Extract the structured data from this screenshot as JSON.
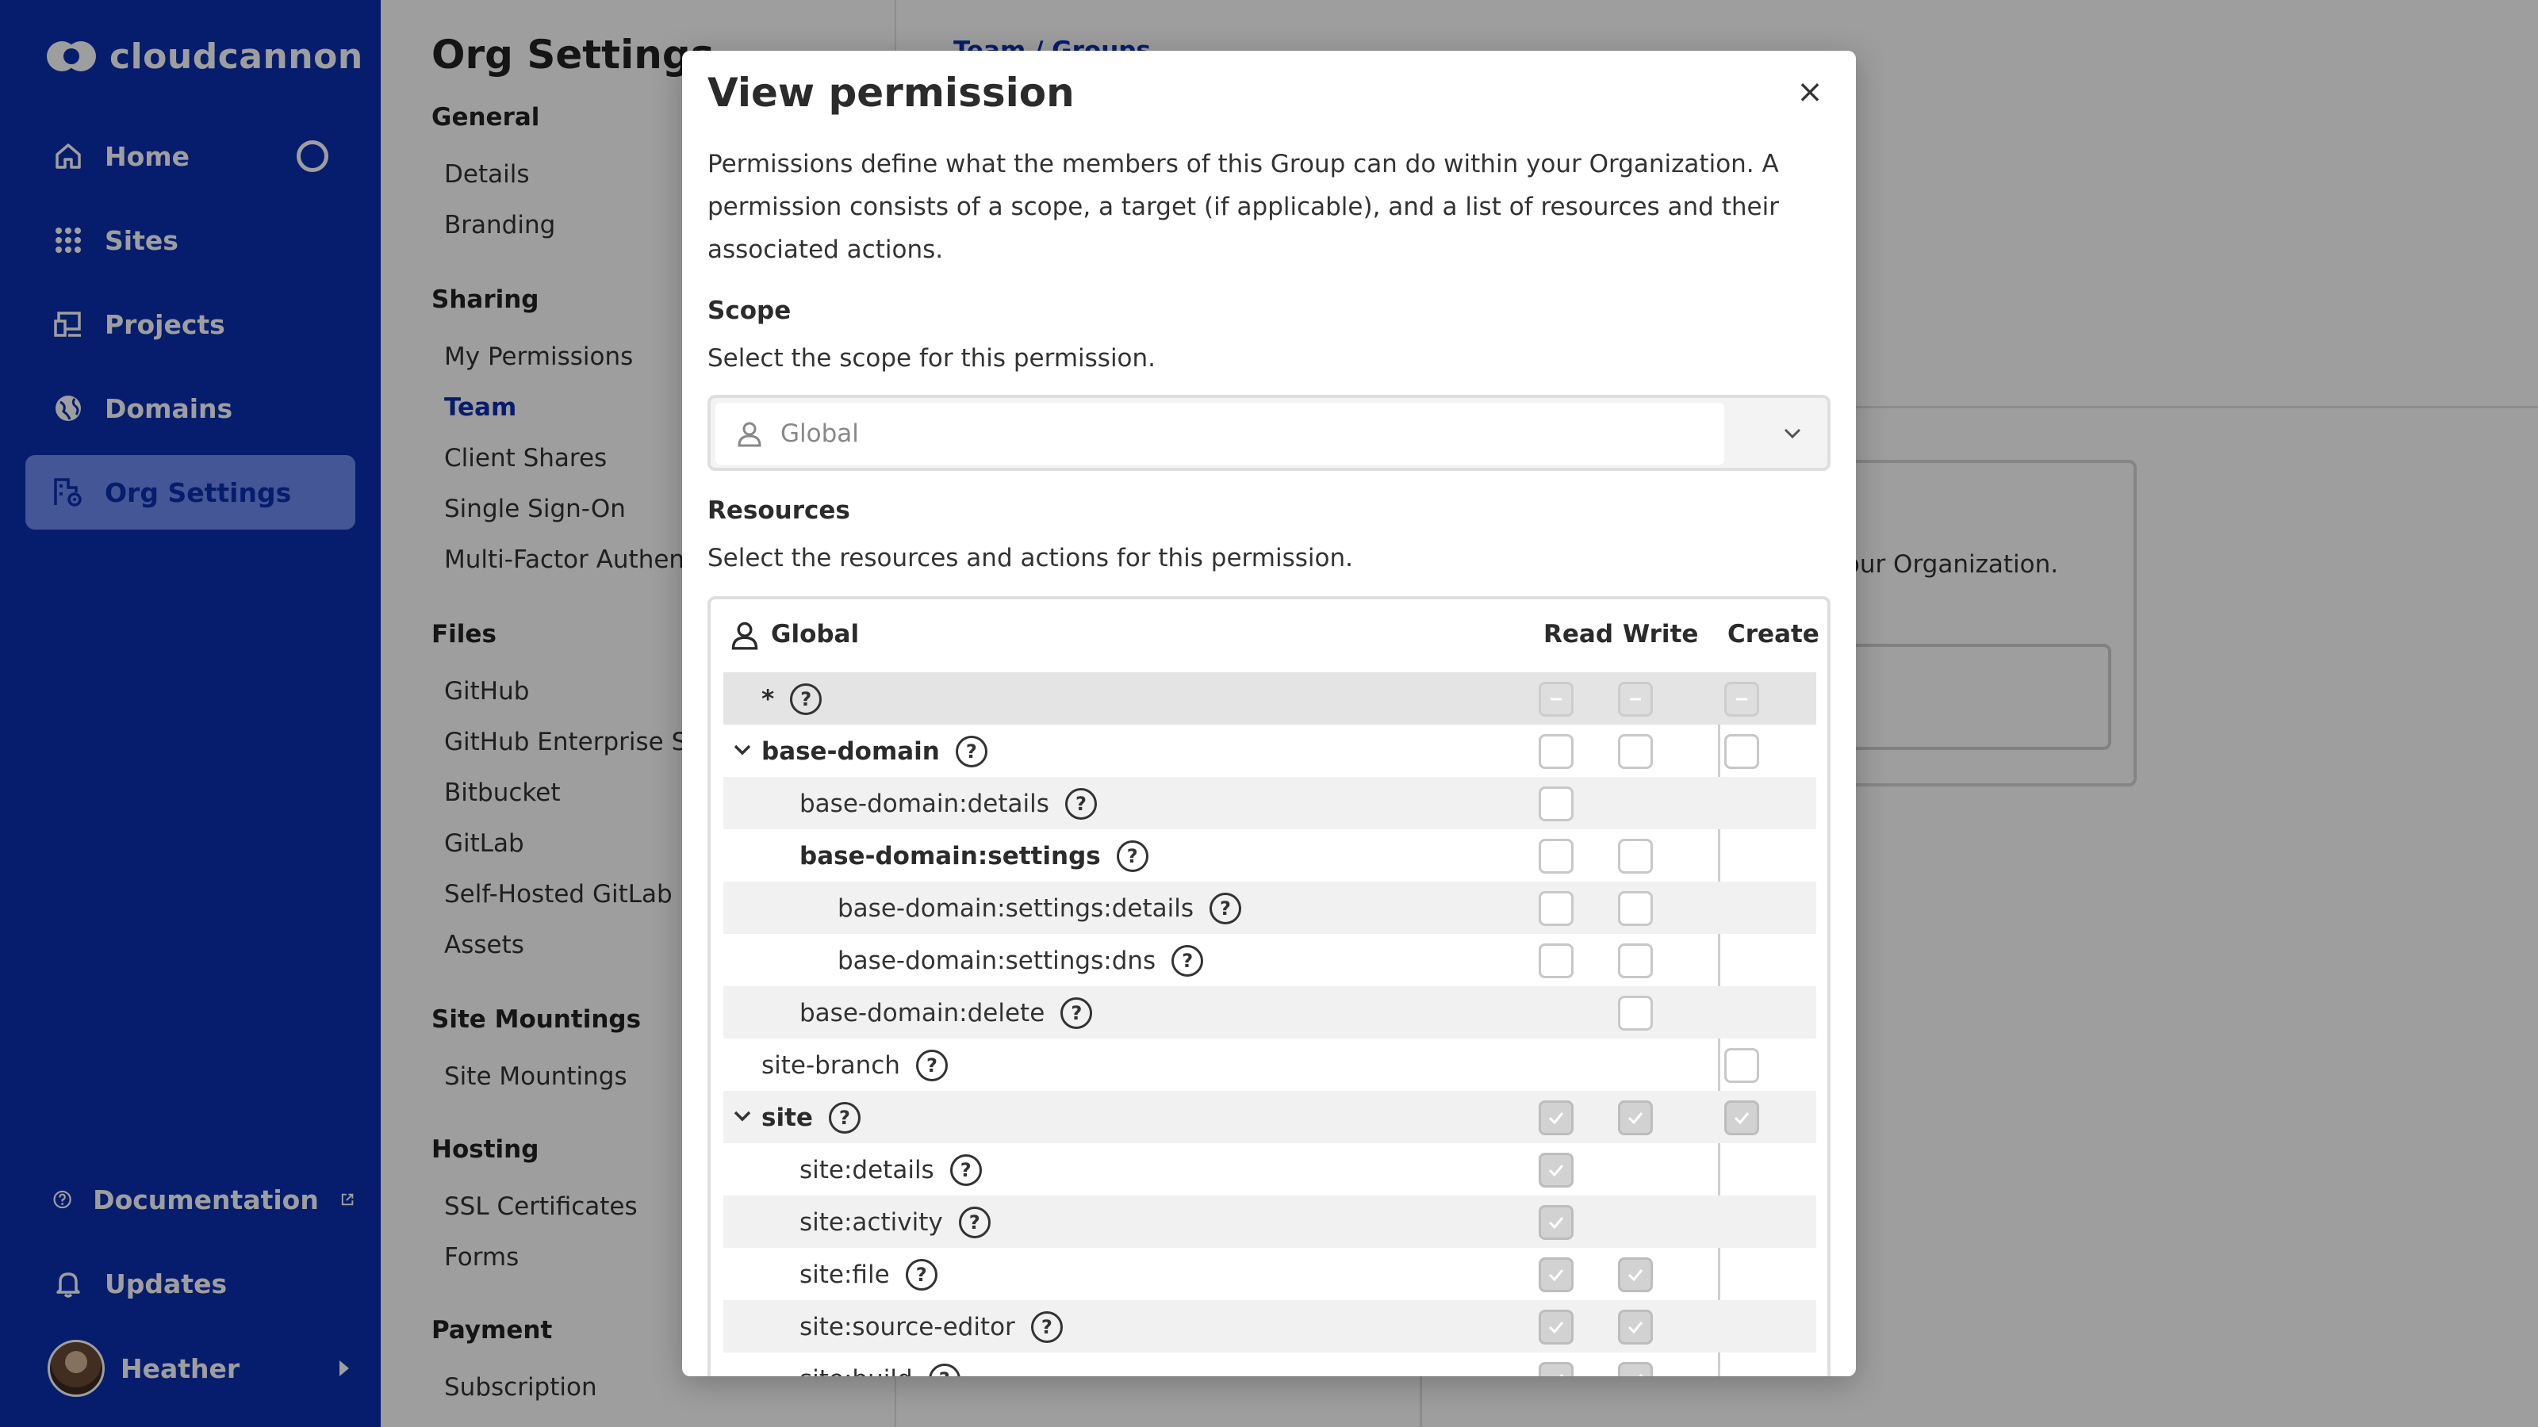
{
  "app": {
    "brand": "cloudcannon"
  },
  "sidebar": {
    "items": [
      {
        "label": "Home",
        "icon": "home-icon"
      },
      {
        "label": "Sites",
        "icon": "grid-icon"
      },
      {
        "label": "Projects",
        "icon": "projects-icon"
      },
      {
        "label": "Domains",
        "icon": "globe-icon"
      },
      {
        "label": "Org Settings",
        "icon": "org-settings-icon",
        "active": true
      }
    ],
    "bottom": [
      {
        "label": "Documentation",
        "icon": "help-icon"
      },
      {
        "label": "Updates",
        "icon": "bell-icon"
      }
    ],
    "user": {
      "name": "Heather"
    }
  },
  "settings": {
    "title": "Org Settings",
    "groups": [
      {
        "title": "General",
        "links": [
          "Details",
          "Branding"
        ]
      },
      {
        "title": "Sharing",
        "links": [
          "My Permissions",
          "Team",
          "Client Shares",
          "Single Sign-On",
          "Multi-Factor Authentication"
        ]
      },
      {
        "title": "Files",
        "links": [
          "GitHub",
          "GitHub Enterprise Server",
          "Bitbucket",
          "GitLab",
          "Self-Hosted GitLab",
          "Assets"
        ]
      },
      {
        "title": "Site Mountings",
        "links": [
          "Site Mountings"
        ]
      },
      {
        "title": "Hosting",
        "links": [
          "SSL Certificates",
          "Forms"
        ]
      },
      {
        "title": "Payment",
        "links": [
          "Subscription"
        ]
      }
    ],
    "current": "Team"
  },
  "main": {
    "breadcrumb": "Team / Groups",
    "background_text": "n your Organization."
  },
  "modal": {
    "title": "View permission",
    "close_label": "×",
    "intro": "Permissions define what the members of this Group can do within your Organization. A permission consists of a scope, a target (if applicable), and a list of resources and their associated actions.",
    "scope": {
      "title": "Scope",
      "description": "Select the scope for this permission.",
      "value": "Global"
    },
    "resources": {
      "title": "Resources",
      "description": "Select the resources and actions for this permission.",
      "table_title": "Global",
      "columns": [
        "Read",
        "Write",
        "Create"
      ],
      "rows": [
        {
          "label": "*",
          "level": 0,
          "bold": true,
          "read": "indeterminate",
          "write": "indeterminate",
          "create": "indeterminate"
        },
        {
          "label": "base-domain",
          "level": 0,
          "bold": true,
          "expander": true,
          "read": "unchecked",
          "write": "unchecked",
          "create": "unchecked"
        },
        {
          "label": "base-domain:details",
          "level": 1,
          "bold": false,
          "read": "unchecked",
          "write": null,
          "create": null
        },
        {
          "label": "base-domain:settings",
          "level": 1,
          "bold": true,
          "read": "unchecked",
          "write": "unchecked",
          "create": null
        },
        {
          "label": "base-domain:settings:details",
          "level": 2,
          "bold": false,
          "read": "unchecked",
          "write": "unchecked",
          "create": null
        },
        {
          "label": "base-domain:settings:dns",
          "level": 2,
          "bold": false,
          "read": "unchecked",
          "write": "unchecked",
          "create": null
        },
        {
          "label": "base-domain:delete",
          "level": 1,
          "bold": false,
          "read": null,
          "write": "unchecked",
          "create": null
        },
        {
          "label": "site-branch",
          "level": 0,
          "bold": false,
          "read": null,
          "write": null,
          "create": "unchecked"
        },
        {
          "label": "site",
          "level": 0,
          "bold": true,
          "expander": true,
          "read": "checked",
          "write": "checked",
          "create": "checked"
        },
        {
          "label": "site:details",
          "level": 1,
          "bold": false,
          "read": "checked",
          "write": null,
          "create": null
        },
        {
          "label": "site:activity",
          "level": 1,
          "bold": false,
          "read": "checked",
          "write": null,
          "create": null
        },
        {
          "label": "site:file",
          "level": 1,
          "bold": false,
          "read": "checked",
          "write": "checked",
          "create": null
        },
        {
          "label": "site:source-editor",
          "level": 1,
          "bold": false,
          "read": "checked",
          "write": "checked",
          "create": null
        },
        {
          "label": "site:build",
          "level": 1,
          "bold": false,
          "read": "checked",
          "write": "checked",
          "create": null
        }
      ]
    }
  },
  "colors": {
    "sidebar": "#0a2fb0",
    "active_bg": "#6f8cf0",
    "link": "#0a2fb0"
  }
}
